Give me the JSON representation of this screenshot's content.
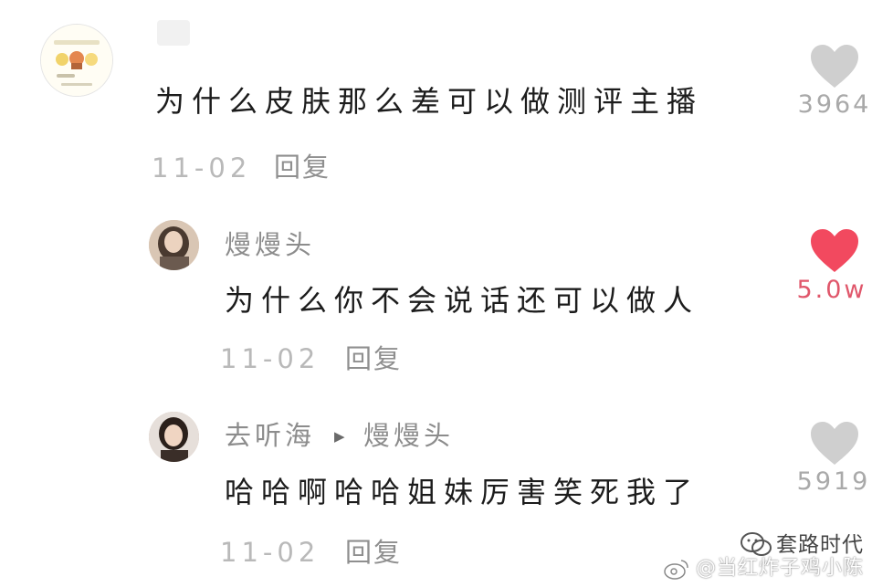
{
  "comments": [
    {
      "author": "",
      "text": "为什么皮肤那么差可以做测评主播",
      "date": "11-02",
      "reply_label": "回复",
      "likes": "3964",
      "liked": false
    },
    {
      "author": "熳熳头",
      "text": "为什么你不会说话还可以做人",
      "date": "11-02",
      "reply_label": "回复",
      "likes": "5.0w",
      "liked": true
    },
    {
      "author": "去听海",
      "reply_to": "熳熳头",
      "text": "哈哈啊哈哈姐妹厉害笑死我了",
      "date": "11-02",
      "reply_label": "回复",
      "likes": "5919",
      "liked": false
    }
  ],
  "watermark": {
    "account": "套路时代",
    "weibo_handle": "@当红炸子鸡小陈"
  },
  "colors": {
    "heart_liked": "#f2495f",
    "heart_default": "#cfcfcf",
    "likes_liked": "#e0576b",
    "likes_default": "#a9a9a9"
  }
}
